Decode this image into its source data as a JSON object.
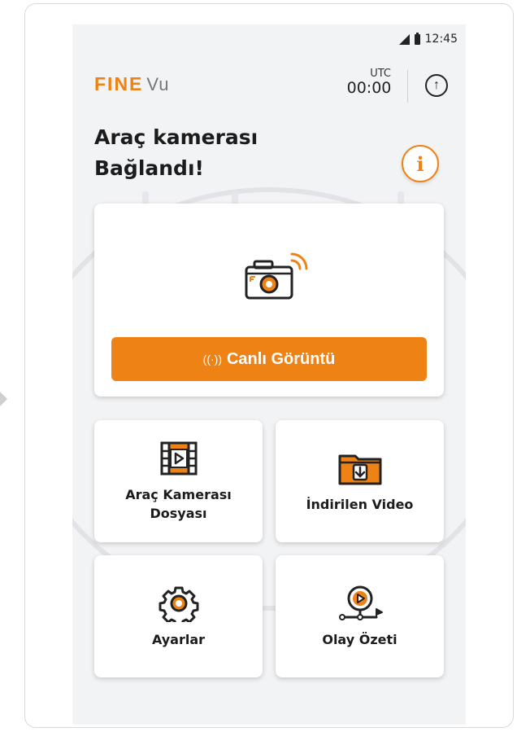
{
  "status_bar": {
    "time": "12:45"
  },
  "brand": {
    "part1": "FINE",
    "part2": "Vu"
  },
  "utc": {
    "label": "UTC",
    "time": "00:00"
  },
  "title": {
    "line1": "Araç kamerası",
    "line2": "Bağlandı!"
  },
  "live": {
    "button_label": "Canlı Görüntü",
    "radio_glyph": "((·))"
  },
  "tiles": [
    {
      "line1": "Araç Kamerası",
      "line2": "Dosyası"
    },
    {
      "line1": "İndirilen Video"
    },
    {
      "line1": "Ayarlar"
    },
    {
      "line1": "Olay Özeti"
    }
  ],
  "colors": {
    "accent": "#ef8215",
    "background": "#f2f3f5",
    "card": "#ffffff",
    "icon_dark": "#222222"
  },
  "icons": [
    "upload-icon",
    "info-icon",
    "camera-wifi-icon",
    "radio-wave-icon",
    "film-icon",
    "download-folder-icon",
    "gear-icon",
    "event-summary-icon"
  ]
}
